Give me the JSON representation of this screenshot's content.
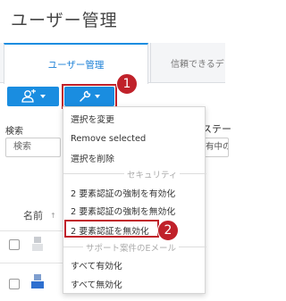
{
  "header": {
    "title": "ユーザー管理"
  },
  "tabs": [
    {
      "label": "ユーザー管理",
      "active": true
    },
    {
      "label": "信頼できるデ",
      "active": false
    }
  ],
  "toolbar": {
    "add_user_icon": "user-plus-icon",
    "tools_icon": "wrench-icon"
  },
  "filters": {
    "search_label": "検索",
    "search_placeholder": "検索",
    "status_label": "ステー",
    "status_value": "有中の"
  },
  "table": {
    "name_header": "名前",
    "sort_indicator": "↑"
  },
  "dropdown_menu": {
    "items_top": [
      "選択を変更",
      "Remove selected",
      "選択を削除"
    ],
    "section_security": "セキュリティ",
    "items_security": [
      "2 要素認証の強制を有効化",
      "2 要素認証の強制を無効化",
      "2 要素認証を無効化"
    ],
    "section_support": "サポート案件のEメール",
    "items_support": [
      "すべて有効化",
      "すべて無効化"
    ]
  },
  "annotations": {
    "step1": "1",
    "step2": "2"
  },
  "colors": {
    "accent": "#1a8de0",
    "highlight": "#c0212a"
  }
}
